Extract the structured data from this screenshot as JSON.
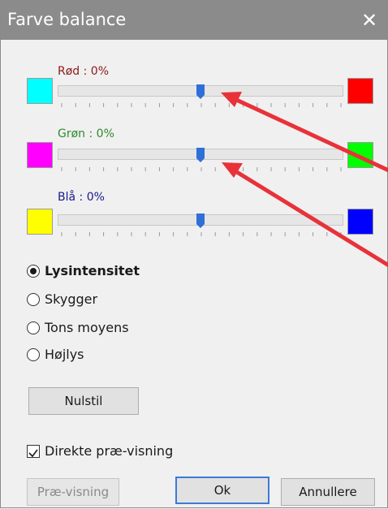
{
  "window": {
    "title": "Farve balance",
    "close_glyph": "✕"
  },
  "sliders": [
    {
      "label": "Rød : 0%",
      "value_percent": 0,
      "label_color": "#8b1a1a",
      "left_color": "#00ffff",
      "right_color": "#ff0000",
      "left_icon": "cyan-swatch",
      "right_icon": "red-swatch"
    },
    {
      "label": "Grøn : 0%",
      "value_percent": 0,
      "label_color": "#2e8b2e",
      "left_color": "#ff00ff",
      "right_color": "#00ff00",
      "left_icon": "magenta-swatch",
      "right_icon": "green-swatch"
    },
    {
      "label": "Blå : 0%",
      "value_percent": 0,
      "label_color": "#1a1a8b",
      "left_color": "#ffff00",
      "right_color": "#0000ff",
      "left_icon": "yellow-swatch",
      "right_icon": "blue-swatch"
    }
  ],
  "tones": {
    "options": [
      "Lysintensitet",
      "Skygger",
      "Tons moyens",
      "Højlys"
    ],
    "selected": "Lysintensitet"
  },
  "reset_label": "Nulstil",
  "preview_checkbox": {
    "label": "Direkte præ-visning",
    "checked": true
  },
  "buttons": {
    "preview": "Præ-visning",
    "ok": "Ok",
    "cancel": "Annullere"
  },
  "colors": {
    "accent": "#2f6fd8",
    "annotation_arrow": "#e8323a"
  }
}
